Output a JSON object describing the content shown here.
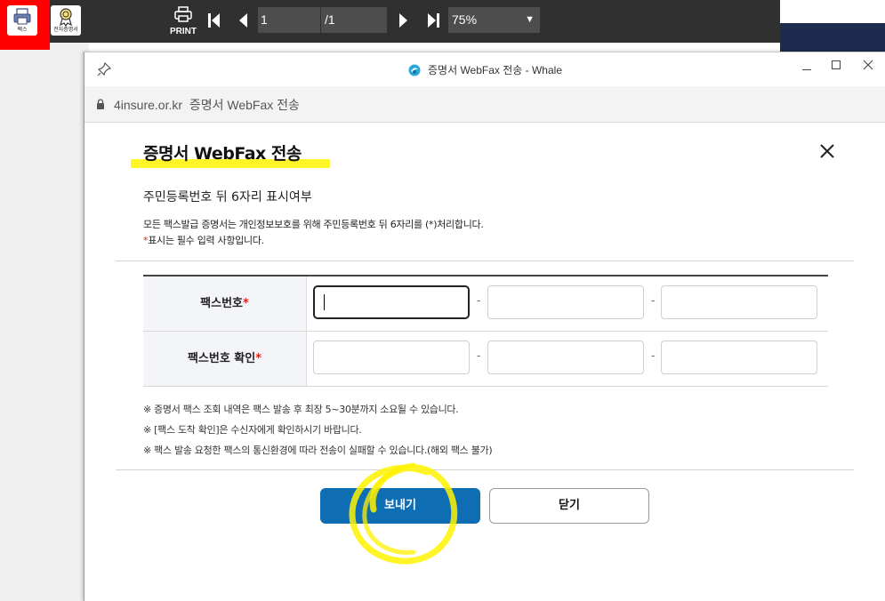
{
  "viewer": {
    "tools": [
      {
        "label": "팩스",
        "icon": "fax-icon"
      },
      {
        "label": "전자증명서",
        "icon": "certificate-icon"
      }
    ],
    "print_label": "PRINT",
    "page_current": "1",
    "page_total": "/1",
    "zoom": "75%"
  },
  "window": {
    "title": "증명서 WebFax 전송 - Whale",
    "url_domain": "4insure.or.kr",
    "url_title": "증명서 WebFax 전송"
  },
  "dialog": {
    "title": "증명서 WebFax 전송",
    "section_title": "주민등록번호 뒤 6자리 표시여부",
    "desc_line1": "모든 팩스발급 증명서는 개인정보보호를 위해 주민등록번호 뒤 6자리를 (*)처리합니다.",
    "desc_line2_mark": "*",
    "desc_line2": "표시는 필수 입력 사항입니다.",
    "form": {
      "rows": [
        {
          "label": "팩스번호",
          "required_mark": "*"
        },
        {
          "label": "팩스번호 확인",
          "required_mark": "*"
        }
      ],
      "separator": "-"
    },
    "notes": [
      "※  증명서 팩스 조회 내역은 팩스 발송 후 최장 5~30분까지 소요될 수 있습니다.",
      "※  [팩스 도착 확인]은 수신자에게 확인하시기 바랍니다.",
      "※  팩스 발송 요청한 팩스의 통신환경에 따라 전송이 실패할 수 있습니다.(해외 팩스 불가)"
    ],
    "send_label": "보내기",
    "close_label": "닫기"
  },
  "colors": {
    "primary": "#0f6db3",
    "required": "#e2231a",
    "highlight": "#fff200",
    "toolbar": "#303030"
  }
}
